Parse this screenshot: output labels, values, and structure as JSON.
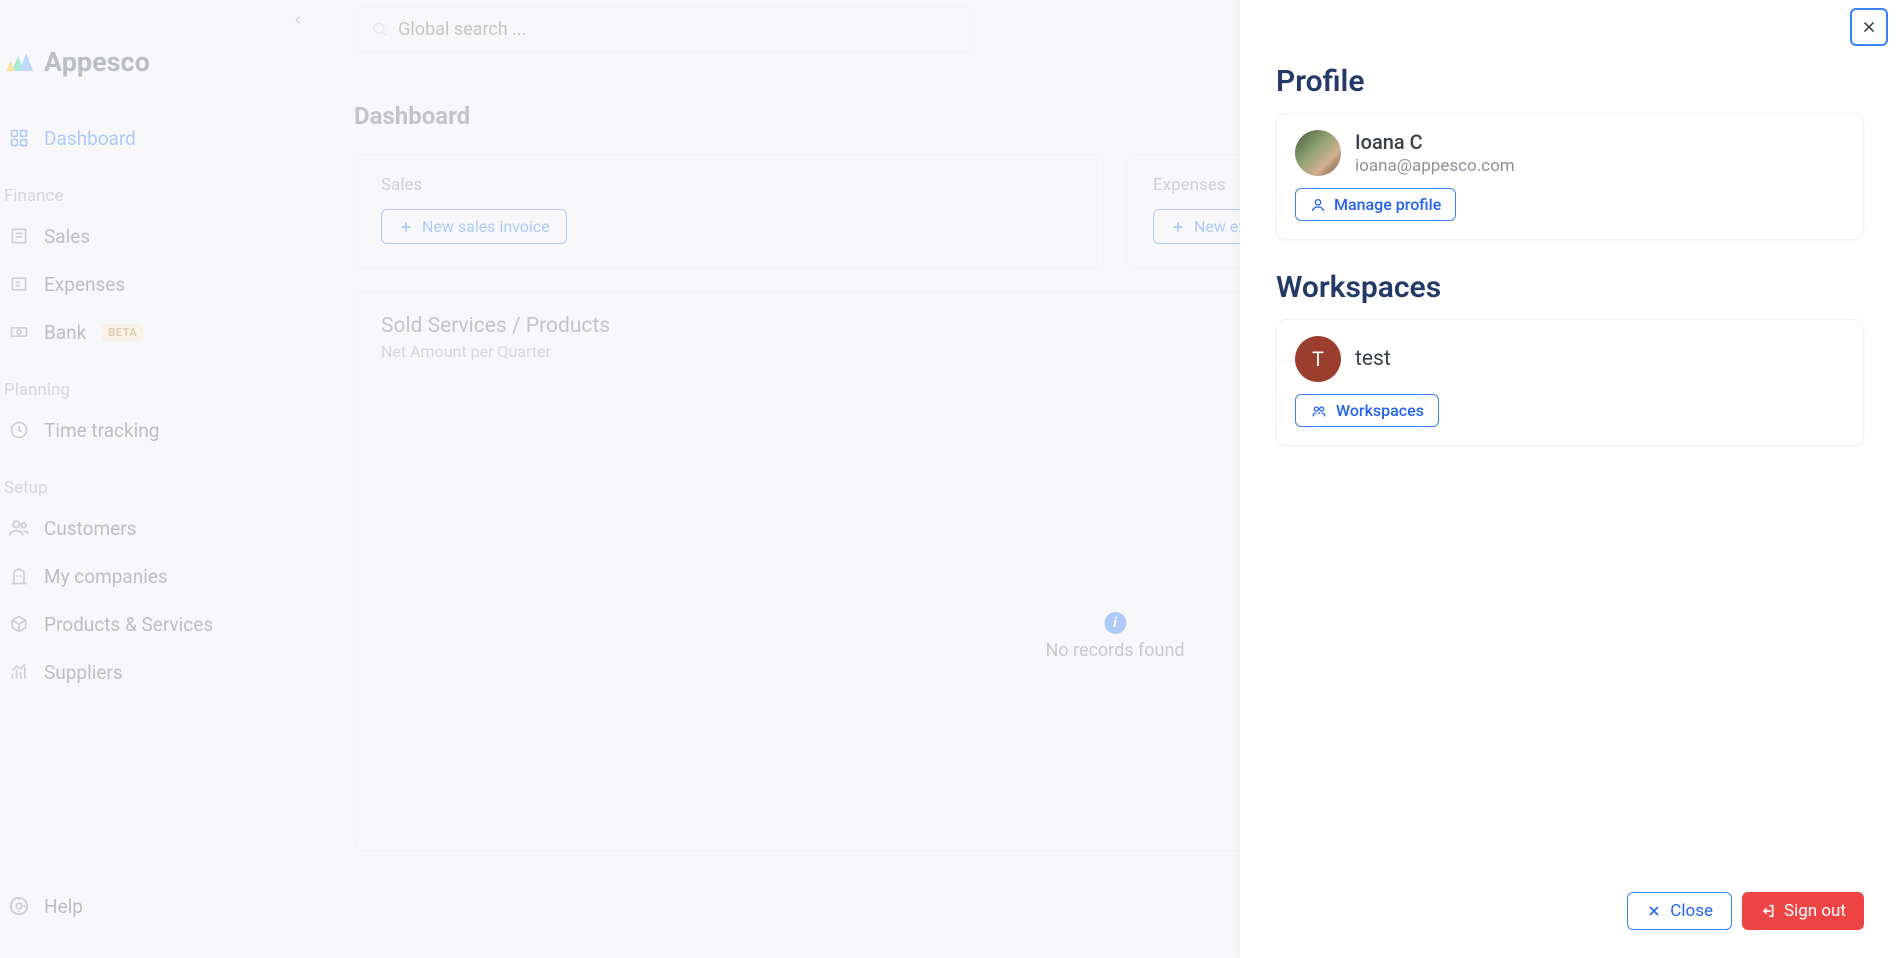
{
  "brand": {
    "name": "Appesco"
  },
  "sidebar": {
    "dashboard": "Dashboard",
    "groups": {
      "finance": {
        "label": "Finance",
        "sales": "Sales",
        "expenses": "Expenses",
        "bank": "Bank",
        "bank_badge": "BETA"
      },
      "planning": {
        "label": "Planning",
        "time": "Time tracking"
      },
      "setup": {
        "label": "Setup",
        "customers": "Customers",
        "companies": "My companies",
        "products": "Products & Services",
        "suppliers": "Suppliers"
      }
    },
    "help": "Help"
  },
  "search": {
    "placeholder": "Global search ..."
  },
  "page": {
    "title": "Dashboard"
  },
  "cards": {
    "sales": {
      "label": "Sales",
      "button": "New sales invoice"
    },
    "expenses": {
      "label": "Expenses",
      "button": "New expense"
    }
  },
  "sold": {
    "title": "Sold Services / Products",
    "subtitle": "Net Amount per Quarter",
    "empty": "No records found"
  },
  "drawer": {
    "profile_heading": "Profile",
    "user_name": "Ioana C",
    "user_email": "ioana@appesco.com",
    "manage_profile": "Manage profile",
    "workspaces_heading": "Workspaces",
    "workspace_name": "test",
    "workspace_initial": "T",
    "workspaces_btn": "Workspaces",
    "close": "Close",
    "signout": "Sign out"
  }
}
